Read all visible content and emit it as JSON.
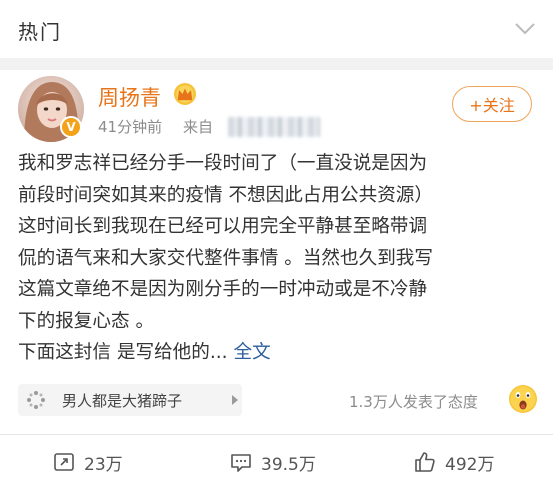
{
  "header": {
    "title": "热门"
  },
  "post": {
    "author": {
      "name": "周扬青",
      "verified_badge": "V"
    },
    "time": "41分钟前",
    "source_label": "来自",
    "follow_label": "+关注",
    "body_lines": [
      "我和罗志祥已经分手一段时间了（一直没说是因为",
      "前段时间突如其来的疫情 不想因此占用公共资源）",
      "这时间长到我现在已经可以用完全平静甚至略带调",
      "侃的语气来和大家交代整件事情 。当然也久到我写",
      "这篇文章绝不是因为刚分手的一时冲动或是不冷静",
      "下的报复心态 。"
    ],
    "last_line": "下面这封信 是写给他的...",
    "read_more": "全文",
    "topic": {
      "label": "男人都是大猪蹄子"
    },
    "reactions_text": "1.3万人发表了态度",
    "actions": {
      "repost": "23万",
      "comment": "39.5万",
      "like": "492万"
    }
  },
  "colors": {
    "name_orange": "#e8741a",
    "link_blue": "#2d5f9e",
    "muted_gray": "#8c8c8c"
  },
  "icons": {
    "header": "chevron-down-icon",
    "crown": "crown-icon",
    "topic": "topic-sparkle-icon",
    "emoji": "wow-emoji-icon",
    "repost": "repost-icon",
    "comment": "comment-icon",
    "like": "like-icon"
  }
}
